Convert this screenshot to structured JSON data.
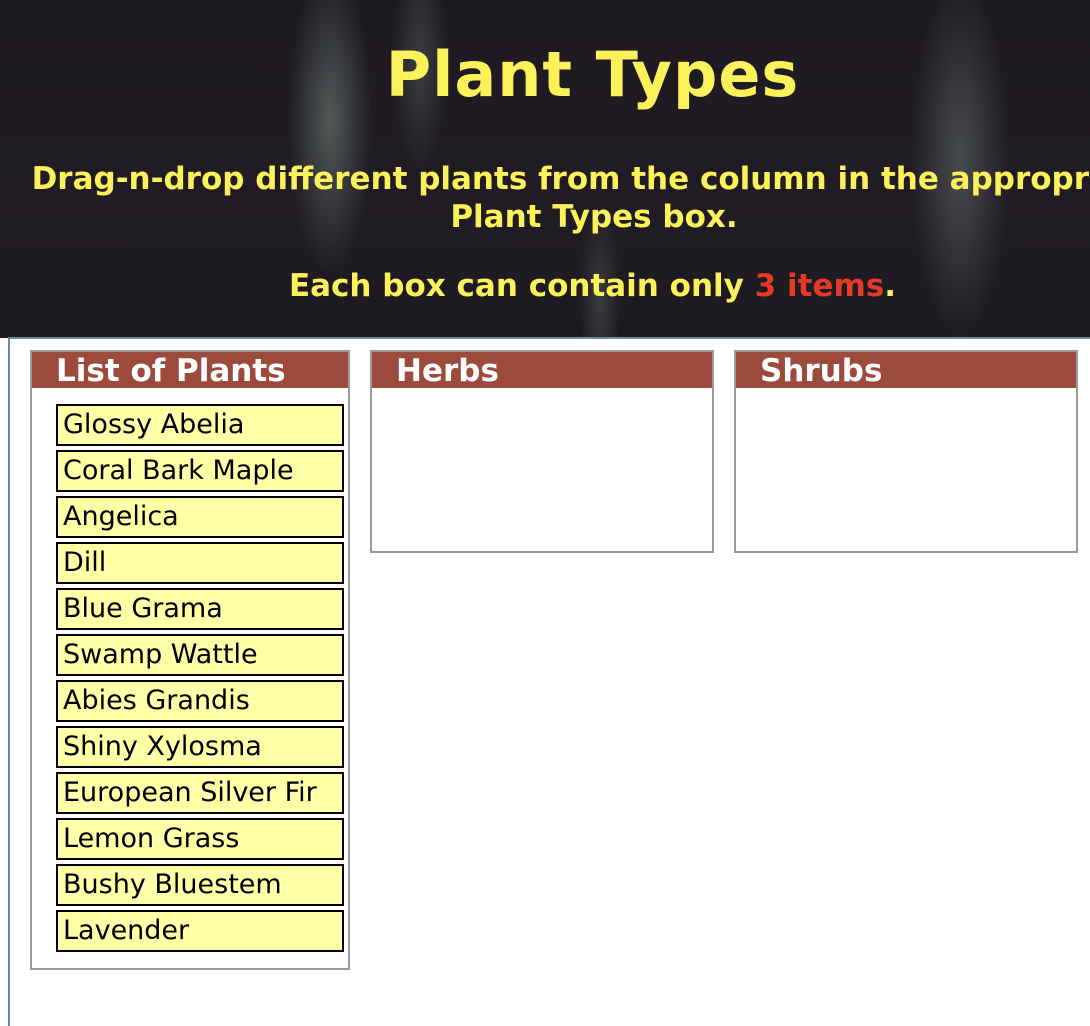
{
  "header": {
    "title": "Plant Types",
    "instructions_line1": "Drag-n-drop different plants from the column in the appropriate",
    "instructions_line2": "Plant Types box.",
    "limit_prefix": "Each box can contain only ",
    "limit_count": "3 items",
    "limit_suffix": "."
  },
  "colors": {
    "title_text": "#fbf15a",
    "limit_highlight": "#e53a26",
    "panel_header": "#9b4a3c",
    "item_background": "#ffffa8"
  },
  "plant_list": {
    "heading": "List of Plants",
    "items": [
      "Glossy Abelia",
      "Coral Bark Maple",
      "Angelica",
      "Dill",
      "Blue Grama",
      "Swamp Wattle",
      "Abies Grandis",
      "Shiny Xylosma",
      "European Silver Fir",
      "Lemon Grass",
      "Bushy Bluestem",
      "Lavender"
    ]
  },
  "categories": [
    {
      "heading": "Herbs",
      "items": []
    },
    {
      "heading": "Shrubs",
      "items": []
    }
  ]
}
